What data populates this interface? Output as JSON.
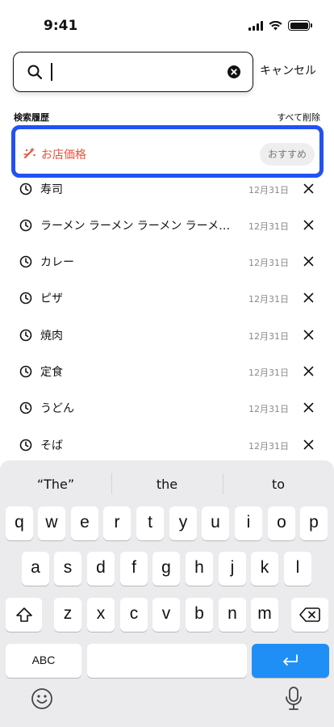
{
  "status": {
    "time": "9:41"
  },
  "search": {
    "value": "",
    "placeholder": "",
    "cancel_label": "キャンセル"
  },
  "history": {
    "title": "検索履歴",
    "clear_all_label": "すべて削除",
    "recommended": {
      "label": "お店価格",
      "badge": "おすすめ"
    },
    "items": [
      {
        "label": "寿司",
        "date": "12月31日"
      },
      {
        "label": "ラーメン ラーメン ラーメン ラーメ…",
        "date": "12月31日"
      },
      {
        "label": "カレー",
        "date": "12月31日"
      },
      {
        "label": "ピザ",
        "date": "12月31日"
      },
      {
        "label": "焼肉",
        "date": "12月31日"
      },
      {
        "label": "定食",
        "date": "12月31日"
      },
      {
        "label": "うどん",
        "date": "12月31日"
      },
      {
        "label": "そば",
        "date": "12月31日"
      }
    ]
  },
  "keyboard": {
    "suggestions": [
      "“The”",
      "the",
      "to"
    ],
    "row1": [
      "q",
      "w",
      "e",
      "r",
      "t",
      "y",
      "u",
      "i",
      "o",
      "p"
    ],
    "row2": [
      "a",
      "s",
      "d",
      "f",
      "g",
      "h",
      "j",
      "k",
      "l"
    ],
    "row3": [
      "z",
      "x",
      "c",
      "v",
      "b",
      "n",
      "m"
    ],
    "abc_label": "ABC"
  },
  "colors": {
    "highlight": "#2451f2",
    "accent_red": "#e8513a",
    "enter_blue": "#1f8ff5"
  }
}
